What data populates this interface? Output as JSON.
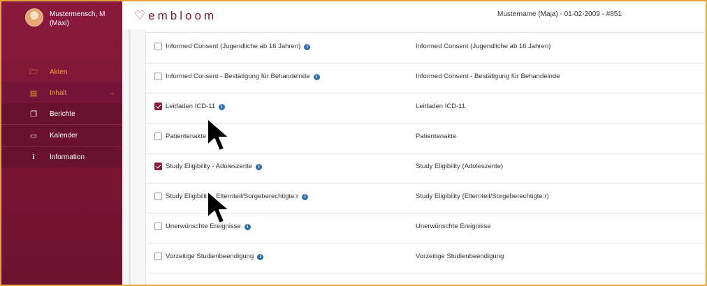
{
  "user": {
    "name": "Mustermensch, M (Maxi)"
  },
  "sidebar": {
    "items": [
      {
        "label": "Akten",
        "icon": "folder-open-icon"
      },
      {
        "label": "Inhalt",
        "icon": "table-icon"
      },
      {
        "label": "Berichte",
        "icon": "copy-icon"
      },
      {
        "label": "Kalender",
        "icon": "monitor-icon"
      },
      {
        "label": "Information",
        "icon": "info-icon"
      }
    ]
  },
  "header": {
    "logo": "embloom",
    "patient": "Mustername (Maja) - 01-02-2009 - #851"
  },
  "rows": [
    {
      "label": "Informed Consent (Jugendliche ab 16 Jahren)",
      "description": "Informed Consent (Jugendliche ab 16 Jahren)",
      "checked": false
    },
    {
      "label": "Informed Consent - Bestätigung für Behandelnde",
      "description": "Informed Consent - Bestätigung für Behandelnde",
      "checked": false
    },
    {
      "label": "Leitfaden ICD-11",
      "description": "Leitfaden ICD-11",
      "checked": true
    },
    {
      "label": "Patientenakte",
      "description": "Patientenakte",
      "checked": false
    },
    {
      "label": "Study Eligibility - Adoleszente",
      "description": "Study Eligibility (Adoleszente)",
      "checked": true
    },
    {
      "label": "Study Eligibility - Elternteil/Sorgeberechtigte:r",
      "description": "Study Eligibility (Elternteil/Sorgeberechtigte:r)",
      "checked": false
    },
    {
      "label": "Unerwünschte Ereignisse",
      "description": "Unerwünschte Ereignisse",
      "checked": false
    },
    {
      "label": "Vorzeitige Studienbeendigung",
      "description": "Vorzeitige Studienbeendigung",
      "checked": false
    }
  ],
  "colors": {
    "brand": "#8a1a3e",
    "accent": "#e8a33c",
    "info": "#2f6fae"
  }
}
